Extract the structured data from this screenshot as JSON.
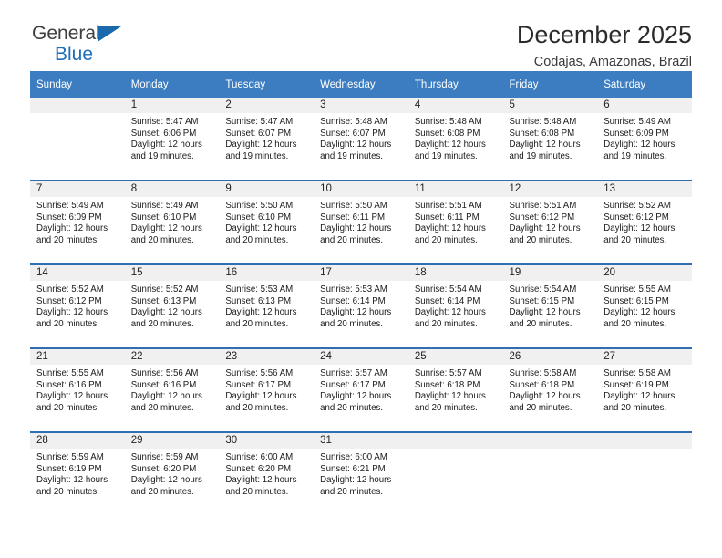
{
  "brand": {
    "name_part1": "General",
    "name_part2": "Blue",
    "logo_icon": "triangle-icon"
  },
  "header": {
    "title": "December 2025",
    "subtitle": "Codajas, Amazonas, Brazil"
  },
  "colors": {
    "header_blue": "#3b7dc0",
    "separator_blue": "#2f6fb0",
    "daynum_bg": "#f0f0f0",
    "brand_blue": "#1d70b8"
  },
  "weekdays": [
    "Sunday",
    "Monday",
    "Tuesday",
    "Wednesday",
    "Thursday",
    "Friday",
    "Saturday"
  ],
  "labels": {
    "sunrise_prefix": "Sunrise:",
    "sunset_prefix": "Sunset:",
    "daylight_prefix": "Daylight:"
  },
  "weeks": [
    [
      {
        "day": "",
        "sunrise": "",
        "sunset": "",
        "daylight_line1": "",
        "daylight_line2": "",
        "empty": true
      },
      {
        "day": "1",
        "sunrise": "Sunrise: 5:47 AM",
        "sunset": "Sunset: 6:06 PM",
        "daylight_line1": "Daylight: 12 hours",
        "daylight_line2": "and 19 minutes."
      },
      {
        "day": "2",
        "sunrise": "Sunrise: 5:47 AM",
        "sunset": "Sunset: 6:07 PM",
        "daylight_line1": "Daylight: 12 hours",
        "daylight_line2": "and 19 minutes."
      },
      {
        "day": "3",
        "sunrise": "Sunrise: 5:48 AM",
        "sunset": "Sunset: 6:07 PM",
        "daylight_line1": "Daylight: 12 hours",
        "daylight_line2": "and 19 minutes."
      },
      {
        "day": "4",
        "sunrise": "Sunrise: 5:48 AM",
        "sunset": "Sunset: 6:08 PM",
        "daylight_line1": "Daylight: 12 hours",
        "daylight_line2": "and 19 minutes."
      },
      {
        "day": "5",
        "sunrise": "Sunrise: 5:48 AM",
        "sunset": "Sunset: 6:08 PM",
        "daylight_line1": "Daylight: 12 hours",
        "daylight_line2": "and 19 minutes."
      },
      {
        "day": "6",
        "sunrise": "Sunrise: 5:49 AM",
        "sunset": "Sunset: 6:09 PM",
        "daylight_line1": "Daylight: 12 hours",
        "daylight_line2": "and 19 minutes."
      }
    ],
    [
      {
        "day": "7",
        "sunrise": "Sunrise: 5:49 AM",
        "sunset": "Sunset: 6:09 PM",
        "daylight_line1": "Daylight: 12 hours",
        "daylight_line2": "and 20 minutes."
      },
      {
        "day": "8",
        "sunrise": "Sunrise: 5:49 AM",
        "sunset": "Sunset: 6:10 PM",
        "daylight_line1": "Daylight: 12 hours",
        "daylight_line2": "and 20 minutes."
      },
      {
        "day": "9",
        "sunrise": "Sunrise: 5:50 AM",
        "sunset": "Sunset: 6:10 PM",
        "daylight_line1": "Daylight: 12 hours",
        "daylight_line2": "and 20 minutes."
      },
      {
        "day": "10",
        "sunrise": "Sunrise: 5:50 AM",
        "sunset": "Sunset: 6:11 PM",
        "daylight_line1": "Daylight: 12 hours",
        "daylight_line2": "and 20 minutes."
      },
      {
        "day": "11",
        "sunrise": "Sunrise: 5:51 AM",
        "sunset": "Sunset: 6:11 PM",
        "daylight_line1": "Daylight: 12 hours",
        "daylight_line2": "and 20 minutes."
      },
      {
        "day": "12",
        "sunrise": "Sunrise: 5:51 AM",
        "sunset": "Sunset: 6:12 PM",
        "daylight_line1": "Daylight: 12 hours",
        "daylight_line2": "and 20 minutes."
      },
      {
        "day": "13",
        "sunrise": "Sunrise: 5:52 AM",
        "sunset": "Sunset: 6:12 PM",
        "daylight_line1": "Daylight: 12 hours",
        "daylight_line2": "and 20 minutes."
      }
    ],
    [
      {
        "day": "14",
        "sunrise": "Sunrise: 5:52 AM",
        "sunset": "Sunset: 6:12 PM",
        "daylight_line1": "Daylight: 12 hours",
        "daylight_line2": "and 20 minutes."
      },
      {
        "day": "15",
        "sunrise": "Sunrise: 5:52 AM",
        "sunset": "Sunset: 6:13 PM",
        "daylight_line1": "Daylight: 12 hours",
        "daylight_line2": "and 20 minutes."
      },
      {
        "day": "16",
        "sunrise": "Sunrise: 5:53 AM",
        "sunset": "Sunset: 6:13 PM",
        "daylight_line1": "Daylight: 12 hours",
        "daylight_line2": "and 20 minutes."
      },
      {
        "day": "17",
        "sunrise": "Sunrise: 5:53 AM",
        "sunset": "Sunset: 6:14 PM",
        "daylight_line1": "Daylight: 12 hours",
        "daylight_line2": "and 20 minutes."
      },
      {
        "day": "18",
        "sunrise": "Sunrise: 5:54 AM",
        "sunset": "Sunset: 6:14 PM",
        "daylight_line1": "Daylight: 12 hours",
        "daylight_line2": "and 20 minutes."
      },
      {
        "day": "19",
        "sunrise": "Sunrise: 5:54 AM",
        "sunset": "Sunset: 6:15 PM",
        "daylight_line1": "Daylight: 12 hours",
        "daylight_line2": "and 20 minutes."
      },
      {
        "day": "20",
        "sunrise": "Sunrise: 5:55 AM",
        "sunset": "Sunset: 6:15 PM",
        "daylight_line1": "Daylight: 12 hours",
        "daylight_line2": "and 20 minutes."
      }
    ],
    [
      {
        "day": "21",
        "sunrise": "Sunrise: 5:55 AM",
        "sunset": "Sunset: 6:16 PM",
        "daylight_line1": "Daylight: 12 hours",
        "daylight_line2": "and 20 minutes."
      },
      {
        "day": "22",
        "sunrise": "Sunrise: 5:56 AM",
        "sunset": "Sunset: 6:16 PM",
        "daylight_line1": "Daylight: 12 hours",
        "daylight_line2": "and 20 minutes."
      },
      {
        "day": "23",
        "sunrise": "Sunrise: 5:56 AM",
        "sunset": "Sunset: 6:17 PM",
        "daylight_line1": "Daylight: 12 hours",
        "daylight_line2": "and 20 minutes."
      },
      {
        "day": "24",
        "sunrise": "Sunrise: 5:57 AM",
        "sunset": "Sunset: 6:17 PM",
        "daylight_line1": "Daylight: 12 hours",
        "daylight_line2": "and 20 minutes."
      },
      {
        "day": "25",
        "sunrise": "Sunrise: 5:57 AM",
        "sunset": "Sunset: 6:18 PM",
        "daylight_line1": "Daylight: 12 hours",
        "daylight_line2": "and 20 minutes."
      },
      {
        "day": "26",
        "sunrise": "Sunrise: 5:58 AM",
        "sunset": "Sunset: 6:18 PM",
        "daylight_line1": "Daylight: 12 hours",
        "daylight_line2": "and 20 minutes."
      },
      {
        "day": "27",
        "sunrise": "Sunrise: 5:58 AM",
        "sunset": "Sunset: 6:19 PM",
        "daylight_line1": "Daylight: 12 hours",
        "daylight_line2": "and 20 minutes."
      }
    ],
    [
      {
        "day": "28",
        "sunrise": "Sunrise: 5:59 AM",
        "sunset": "Sunset: 6:19 PM",
        "daylight_line1": "Daylight: 12 hours",
        "daylight_line2": "and 20 minutes."
      },
      {
        "day": "29",
        "sunrise": "Sunrise: 5:59 AM",
        "sunset": "Sunset: 6:20 PM",
        "daylight_line1": "Daylight: 12 hours",
        "daylight_line2": "and 20 minutes."
      },
      {
        "day": "30",
        "sunrise": "Sunrise: 6:00 AM",
        "sunset": "Sunset: 6:20 PM",
        "daylight_line1": "Daylight: 12 hours",
        "daylight_line2": "and 20 minutes."
      },
      {
        "day": "31",
        "sunrise": "Sunrise: 6:00 AM",
        "sunset": "Sunset: 6:21 PM",
        "daylight_line1": "Daylight: 12 hours",
        "daylight_line2": "and 20 minutes."
      },
      {
        "day": "",
        "sunrise": "",
        "sunset": "",
        "daylight_line1": "",
        "daylight_line2": "",
        "empty": true
      },
      {
        "day": "",
        "sunrise": "",
        "sunset": "",
        "daylight_line1": "",
        "daylight_line2": "",
        "empty": true
      },
      {
        "day": "",
        "sunrise": "",
        "sunset": "",
        "daylight_line1": "",
        "daylight_line2": "",
        "empty": true
      }
    ]
  ]
}
